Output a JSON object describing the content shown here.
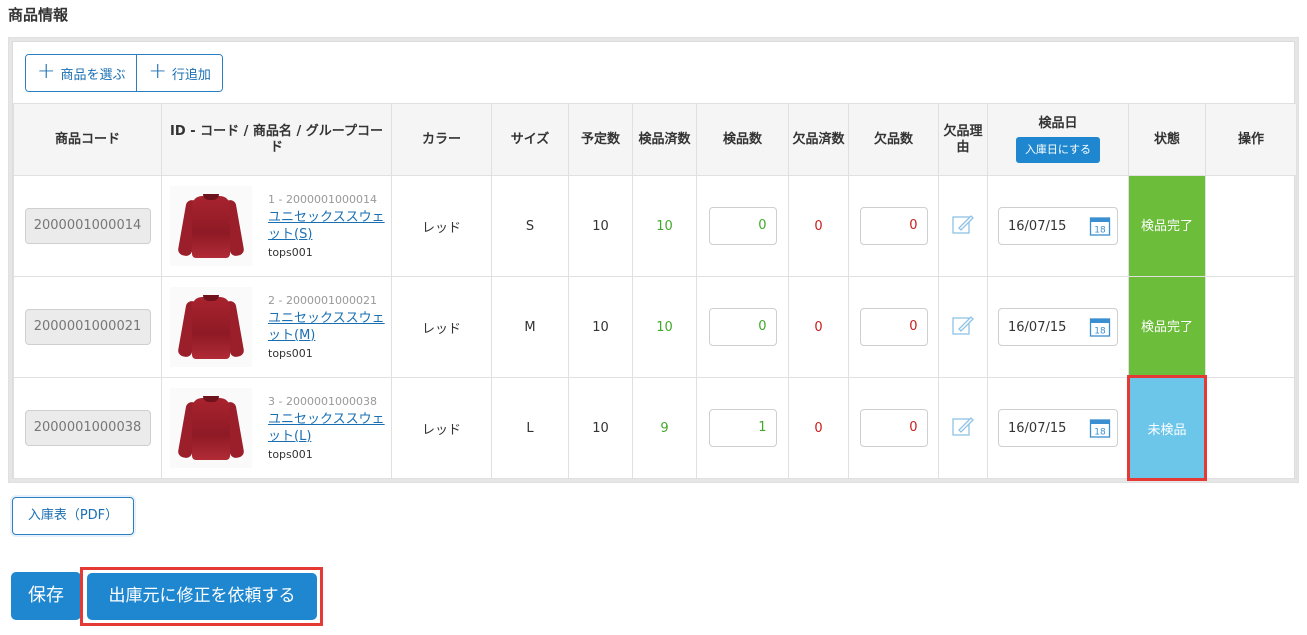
{
  "section_title": "商品情報",
  "toolbar": {
    "select_products": "商品を選ぶ",
    "add_row": "行追加"
  },
  "columns": {
    "code": "商品コード",
    "product": "ID - コード / 商品名 / グループコード",
    "color": "カラー",
    "size": "サイズ",
    "planned": "予定数",
    "inspected_done": "検品済数",
    "inspect_qty": "検品数",
    "missing_done": "欠品済数",
    "missing_qty": "欠品数",
    "missing_reason": "欠品理由",
    "inspect_date": "検品日",
    "set_receipt_date": "入庫日にする",
    "status": "状態",
    "actions": "操作"
  },
  "rows": [
    {
      "code": "2000001000014",
      "product_id": "1 - 2000001000014",
      "product_name": "ユニセックススウェット(S)",
      "group_code": "tops001",
      "color": "レッド",
      "size": "S",
      "planned": "10",
      "inspected_done": "10",
      "inspect_qty": "0",
      "missing_done": "0",
      "missing_qty": "0",
      "date": "16/07/15",
      "status": "検品完了"
    },
    {
      "code": "2000001000021",
      "product_id": "2 - 2000001000021",
      "product_name": "ユニセックススウェット(M)",
      "group_code": "tops001",
      "color": "レッド",
      "size": "M",
      "planned": "10",
      "inspected_done": "10",
      "inspect_qty": "0",
      "missing_done": "0",
      "missing_qty": "0",
      "date": "16/07/15",
      "status": "検品完了"
    },
    {
      "code": "2000001000038",
      "product_id": "3 - 2000001000038",
      "product_name": "ユニセックススウェット(L)",
      "group_code": "tops001",
      "color": "レッド",
      "size": "L",
      "planned": "10",
      "inspected_done": "9",
      "inspect_qty": "1",
      "missing_done": "0",
      "missing_qty": "0",
      "date": "16/07/15",
      "status": "未検品"
    }
  ],
  "calendar_day": "18",
  "buttons": {
    "pdf": "入庫表（PDF）",
    "save": "保存",
    "request_fix": "出庫元に修正を依頼する"
  },
  "colors": {
    "primary": "#1e87d0",
    "done": "#6bbd3a",
    "pending": "#6cc6ea",
    "highlight": "#e53935"
  },
  "icons": {
    "plus": "plus-icon",
    "edit": "edit-icon",
    "calendar": "calendar-icon"
  }
}
